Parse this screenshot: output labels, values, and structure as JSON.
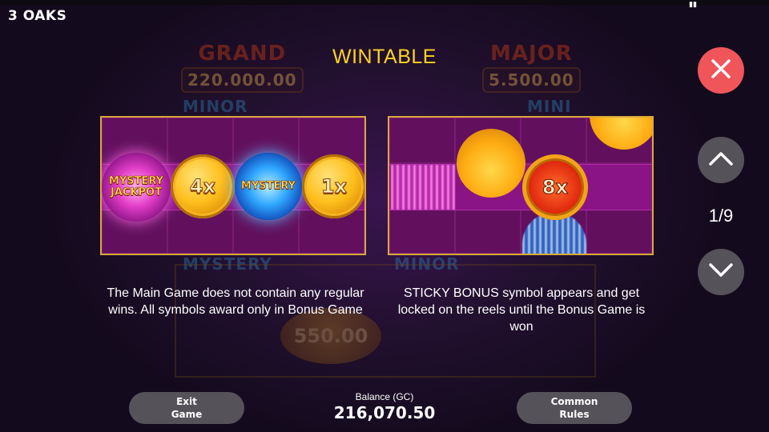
{
  "app": {
    "brand": "3 OAKS"
  },
  "background": {
    "jackpots": [
      {
        "name": "GRAND",
        "value": "220.000.00"
      },
      {
        "name": "MAJOR",
        "value": "5.500.00"
      }
    ],
    "tags": [
      "MINOR",
      "MINI",
      "MYSTERY",
      "MINOR"
    ],
    "coin_value": "550.00"
  },
  "title": "WINTABLE",
  "panels": {
    "left": {
      "symbols": [
        {
          "type": "orb-pink",
          "label_line1": "MYSTERY",
          "label_line2": "JACKPOT"
        },
        {
          "type": "coin",
          "label": "4x"
        },
        {
          "type": "orb-blue",
          "label_line1": "MYSTERY",
          "label_line2": ""
        },
        {
          "type": "coin",
          "label": "1x"
        }
      ],
      "description": "The Main Game does not contain any regular wins. All symbols award only in Bonus Game"
    },
    "right": {
      "sticky_label": "8x",
      "description": "STICKY BONUS symbol appears and get locked on the reels until the Bonus Game is won"
    }
  },
  "navigation": {
    "page_indicator": "1/9"
  },
  "footer": {
    "exit_line1": "Exit",
    "exit_line2": "Game",
    "rules_line1": "Common",
    "rules_line2": "Rules",
    "balance_label": "Balance (GC)",
    "balance_value": "216,070.50"
  },
  "colors": {
    "title": "#ffd21e",
    "close_button": "#f0555a",
    "nav_button": "#55525a",
    "panel_border": "#d9a93a"
  },
  "icons": {
    "close": "close-icon",
    "up": "chevron-up-icon",
    "down": "chevron-down-icon"
  }
}
